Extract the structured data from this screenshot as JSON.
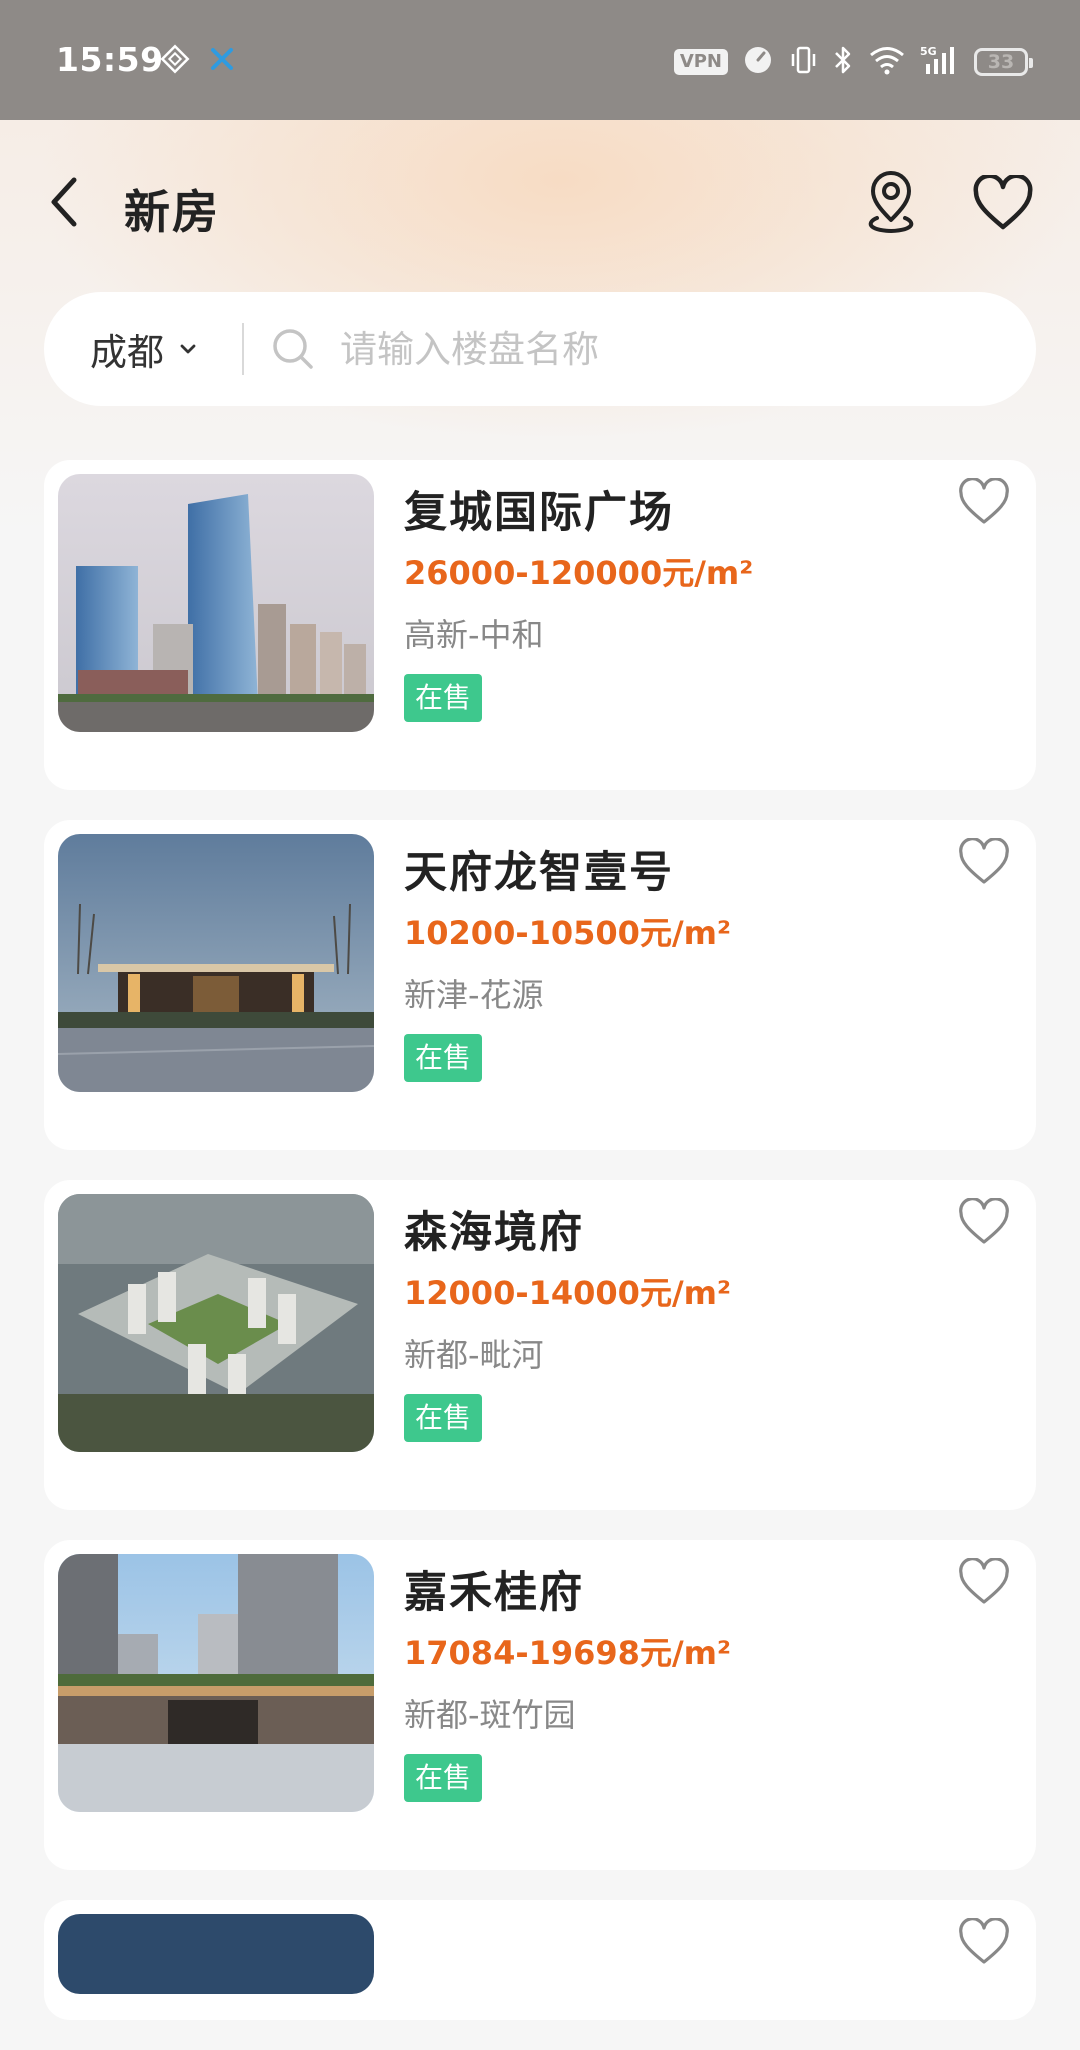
{
  "status_bar": {
    "time": "15:59",
    "vpn": "VPN",
    "network": "5G",
    "battery": "33",
    "icons": [
      "nfc-icon",
      "bluetooth-tether-icon",
      "vpn-icon",
      "speed-icon",
      "vibrate-icon",
      "bluetooth-icon",
      "wifi-icon",
      "signal-icon",
      "battery-icon"
    ]
  },
  "header": {
    "title": "新房",
    "back_icon": "back-arrow-icon",
    "map_icon": "map-pin-icon",
    "favorites_icon": "heart-icon"
  },
  "search": {
    "city": "成都",
    "placeholder": "请输入楼盘名称"
  },
  "listings": [
    {
      "name": "复城国际广场",
      "price": "26000-120000元/m²",
      "area": "高新-中和",
      "status": "在售",
      "image": "glass-office-towers"
    },
    {
      "name": "天府龙智壹号",
      "price": "10200-10500元/m²",
      "area": "新津-花源",
      "status": "在售",
      "image": "lit-entrance-gate"
    },
    {
      "name": "森海境府",
      "price": "12000-14000元/m²",
      "area": "新都-毗河",
      "status": "在售",
      "image": "aerial-residential-complex"
    },
    {
      "name": "嘉禾桂府",
      "price": "17084-19698元/m²",
      "area": "新都-斑竹园",
      "status": "在售",
      "image": "residential-gate-plaza"
    }
  ],
  "colors": {
    "price": "#e8661b",
    "status_badge": "#3ec88d",
    "status_bar_bg": "#8e8a87"
  }
}
